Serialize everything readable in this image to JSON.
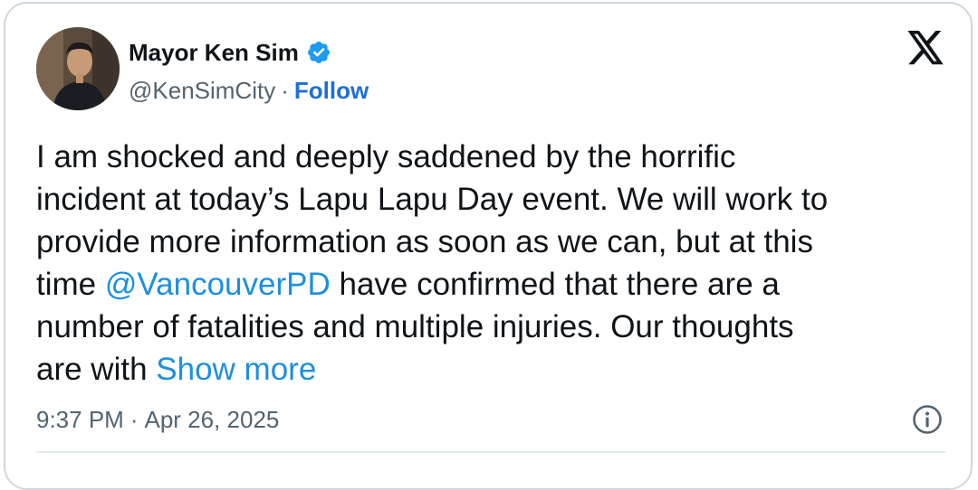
{
  "author": {
    "display_name": "Mayor Ken Sim",
    "handle": "@KenSimCity",
    "separator": "·",
    "follow_label": "Follow",
    "avatar_icon": "profile-photo",
    "verified_icon": "verified-badge-icon",
    "verified_color": "#1d9bf0"
  },
  "platform": {
    "logo_icon": "x-logo-icon"
  },
  "tweet": {
    "line1": "I am shocked and deeply saddened by the horrific",
    "line2": "incident at today’s Lapu Lapu Day event. We will work to",
    "line3": "provide more information as soon as we can, but at this",
    "line4_pre": "time ",
    "mention": "@VancouverPD",
    "line4_post": " have confirmed that there are a",
    "line5": "number of fatalities and multiple injuries. Our thoughts",
    "line6_pre": "are with ",
    "show_more_label": "Show more"
  },
  "meta": {
    "time": "9:37 PM",
    "separator": "·",
    "date": "Apr 26, 2025",
    "info_icon": "info-circle-icon"
  },
  "colors": {
    "link": "#1d8fe0",
    "follow": "#1d6fd6",
    "text": "#0f1419",
    "secondary": "#536471",
    "border": "#cfd9de"
  }
}
